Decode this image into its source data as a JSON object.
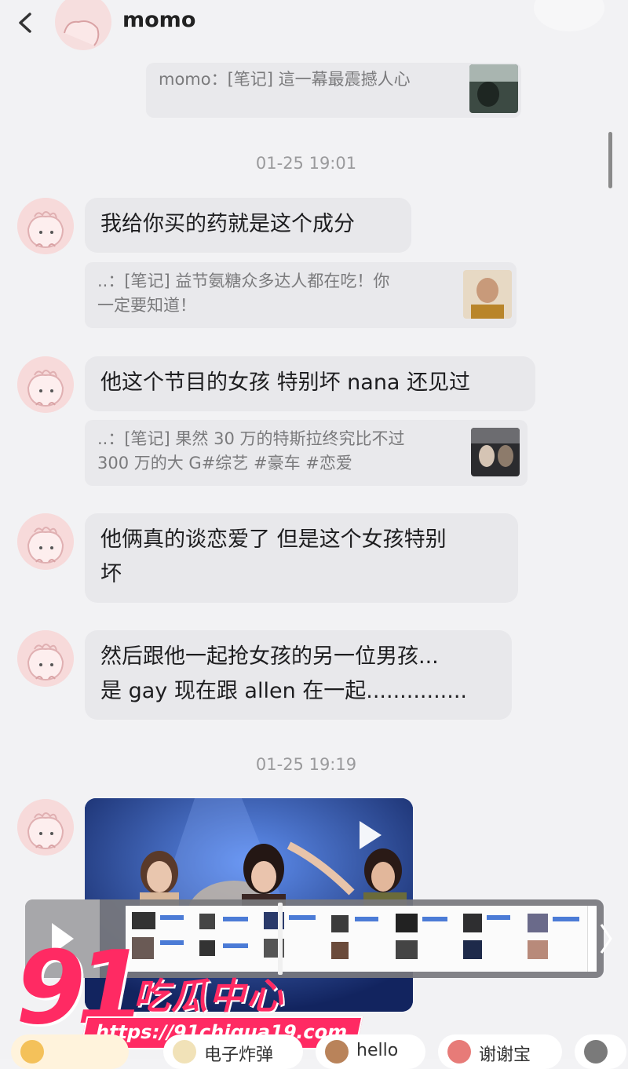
{
  "header": {
    "title": "momo"
  },
  "messages": [
    {
      "type": "quote",
      "text": "momo：[笔记] 這一幕最震撼人心"
    },
    {
      "type": "timestamp",
      "text": "01-25 19:01"
    },
    {
      "type": "bubble",
      "lines": [
        "我给你买的药就是这个成分"
      ]
    },
    {
      "type": "quote",
      "lines": [
        "..：[笔记] 益节氨糖众多达人都在吃！你",
        "一定要知道！"
      ]
    },
    {
      "type": "bubble",
      "lines": [
        "他这个节目的女孩 特别坏 nana 还见过"
      ]
    },
    {
      "type": "quote",
      "lines": [
        "..：[笔记] 果然 30 万的特斯拉终究比不过",
        "300 万的大 G#综艺 #豪车 #恋爱"
      ]
    },
    {
      "type": "bubble",
      "lines": [
        "他俩真的谈恋爱了 但是这个女孩特别",
        "坏"
      ]
    },
    {
      "type": "bubble",
      "lines": [
        "然后跟他一起抢女孩的另一位男孩...",
        "是 gay 现在跟 allen 在一起..............."
      ]
    },
    {
      "type": "timestamp",
      "text": "01-25 19:19"
    }
  ],
  "watermark": {
    "number": "91",
    "name": "吃瓜中心",
    "url": "https://91chigua19.com"
  },
  "quick_replies": [
    {
      "label": "",
      "icon": "sunflower-icon"
    },
    {
      "label": "电子炸弹",
      "icon": "sticker-icon"
    },
    {
      "label": "hello",
      "icon": "monkey-icon"
    },
    {
      "label": "谢谢宝",
      "icon": "flower-icon"
    },
    {
      "label": "",
      "icon": "cat-icon"
    }
  ],
  "colors": {
    "accent": "#ff2a63",
    "bubble": "#e8e8eb",
    "background": "#f2f2f4"
  }
}
